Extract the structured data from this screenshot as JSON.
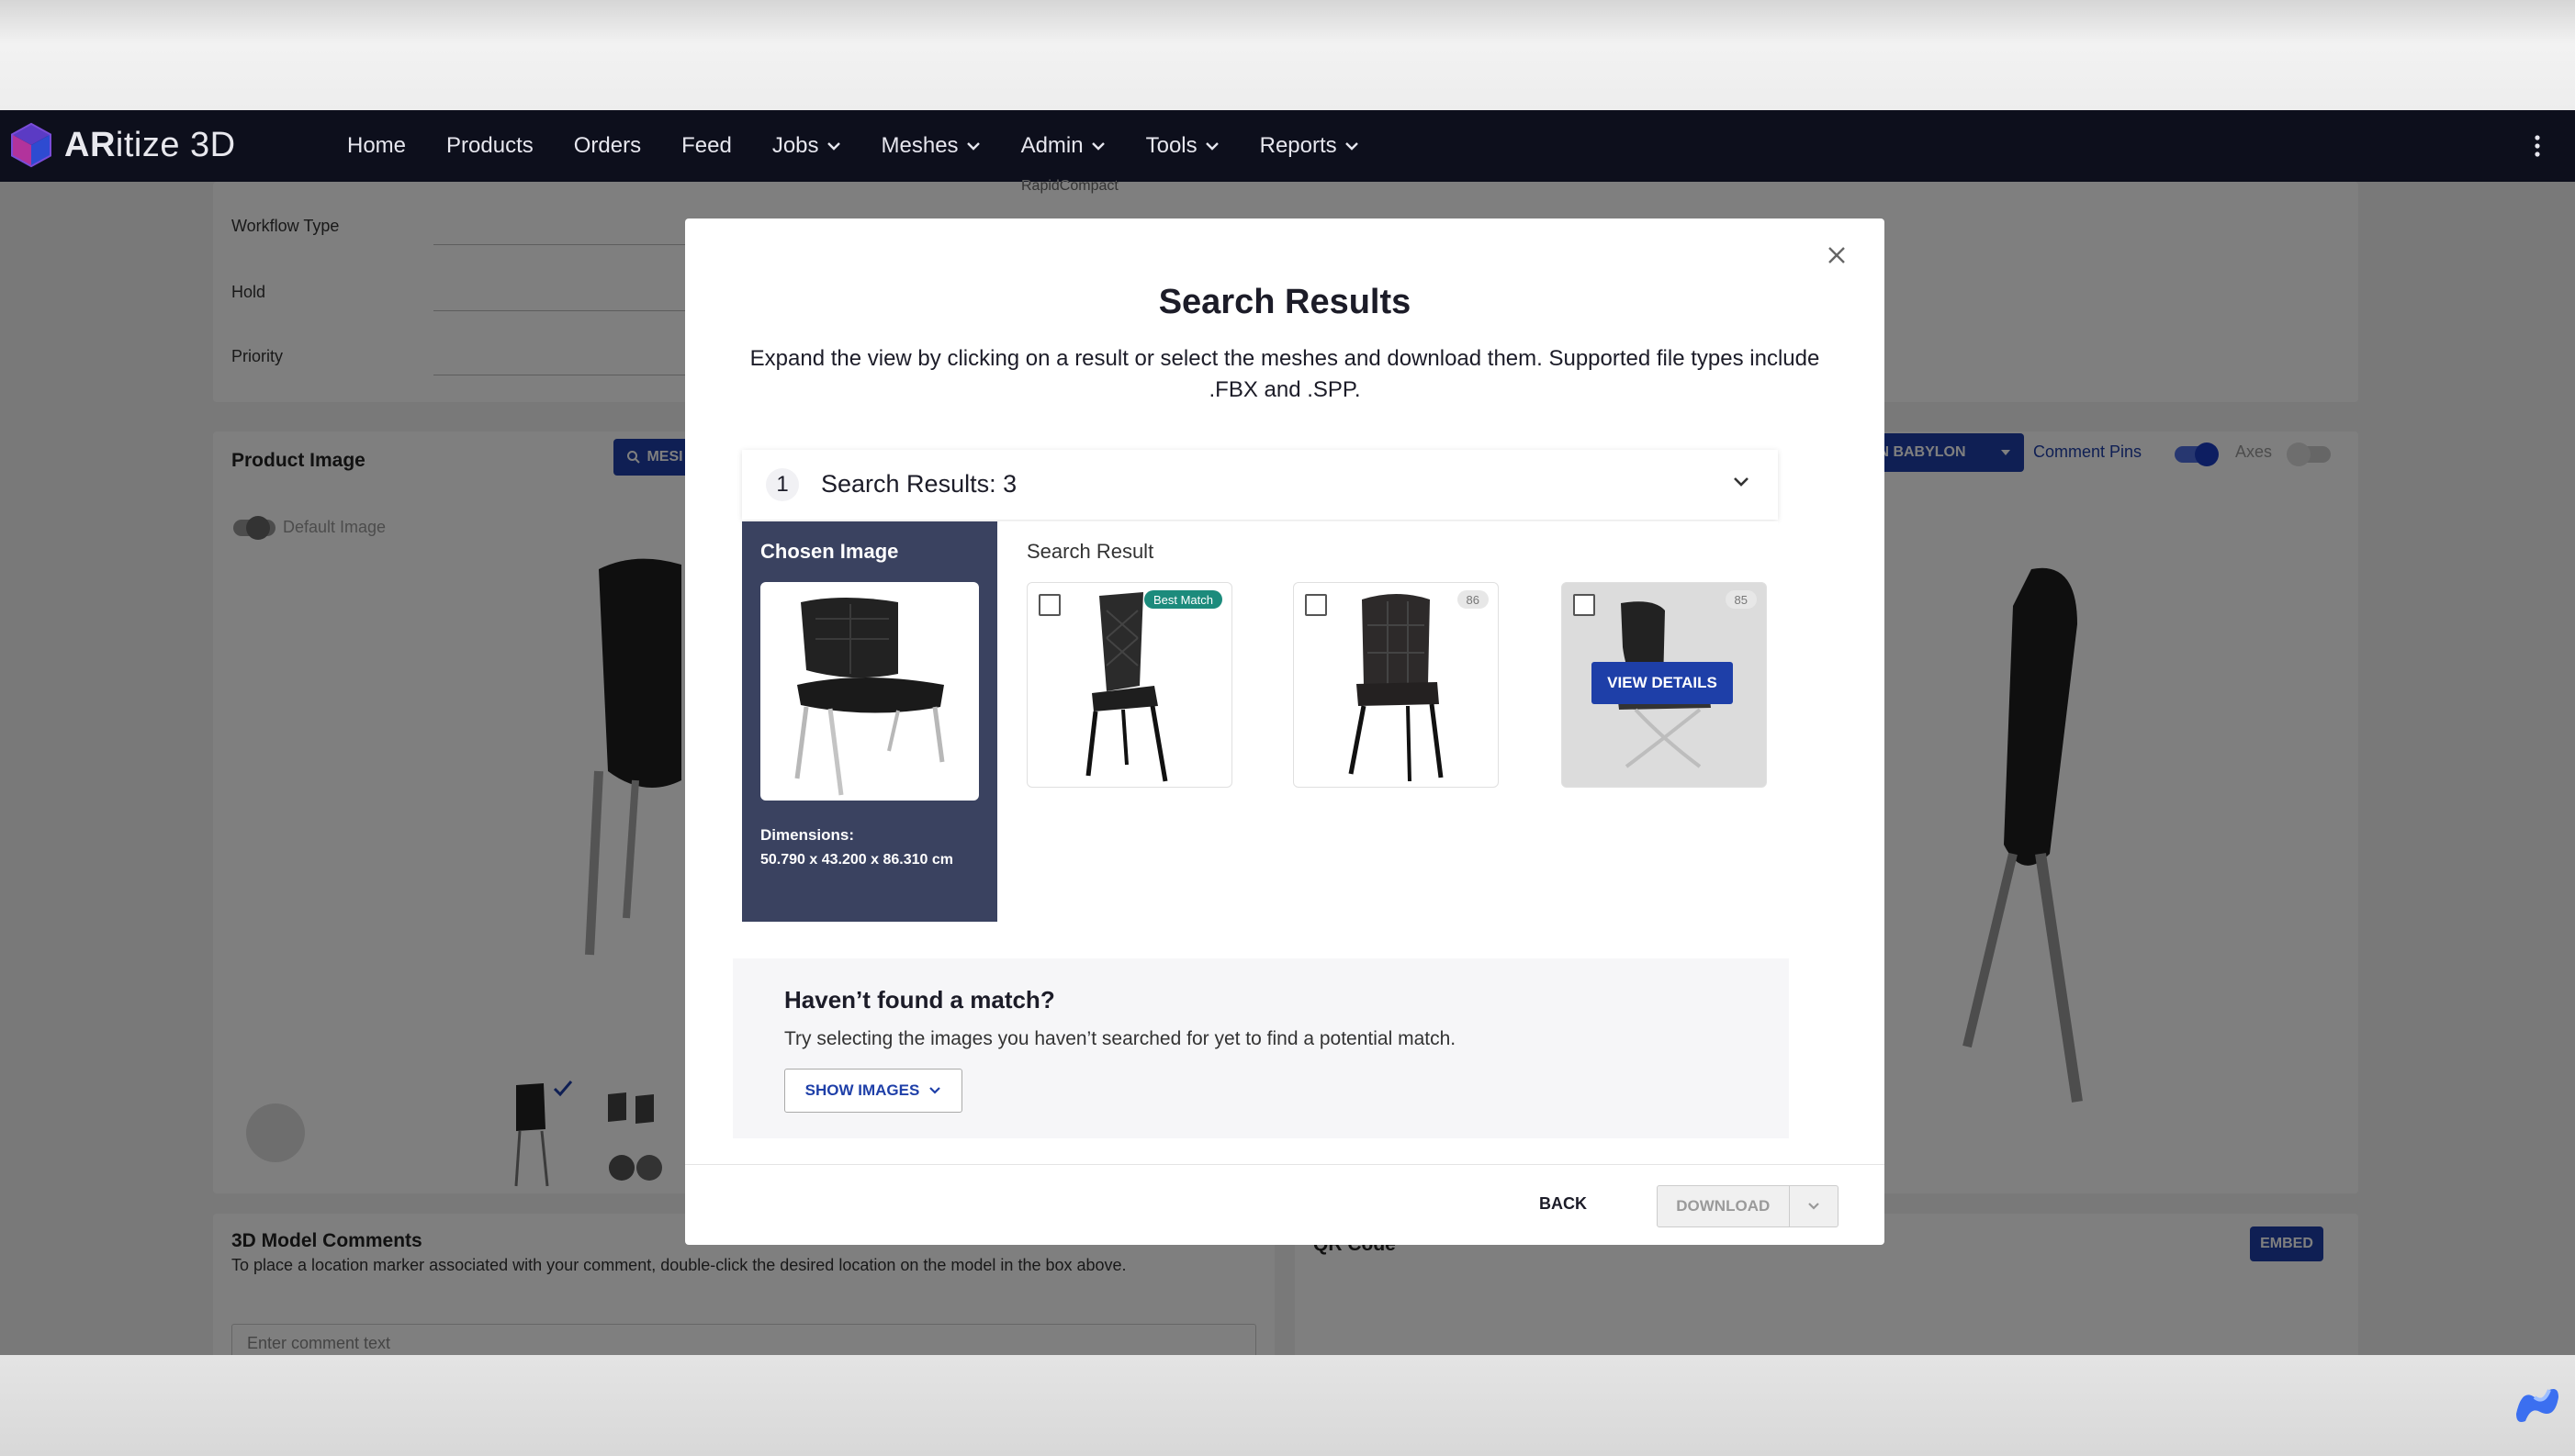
{
  "app": {
    "brand_prefix": "AR",
    "brand_suffix": "itize 3D"
  },
  "nav": {
    "items": [
      {
        "label": "Home",
        "dropdown": false
      },
      {
        "label": "Products",
        "dropdown": false
      },
      {
        "label": "Orders",
        "dropdown": false
      },
      {
        "label": "Feed",
        "dropdown": false
      },
      {
        "label": "Jobs",
        "dropdown": true
      },
      {
        "label": "Meshes",
        "dropdown": true
      },
      {
        "label": "Admin",
        "dropdown": true
      },
      {
        "label": "Tools",
        "dropdown": true
      },
      {
        "label": "Reports",
        "dropdown": true
      }
    ]
  },
  "background": {
    "fields": {
      "workflow_type": "Workflow Type",
      "hold": "Hold",
      "priority": "Priority"
    },
    "partial_value": "RapidCompact",
    "product_image": {
      "title": "Product Image",
      "mesh_button": "MESI",
      "default_image": "Default Image"
    },
    "viewer_controls": {
      "babylon_button": "N BABYLON",
      "comment_pins": "Comment Pins",
      "axes": "Axes"
    },
    "comments": {
      "title": "3D Model Comments",
      "hint": "To place a location marker associated with your comment, double-click the desired location on the model in the box above.",
      "placeholder": "Enter comment text"
    },
    "qr": {
      "title": "QR Code",
      "embed": "EMBED"
    }
  },
  "modal": {
    "title": "Search Results",
    "description": "Expand the view by clicking on a result or select the meshes and download them. Supported file types include .FBX and .SPP.",
    "accordion": {
      "number": "1",
      "title": "Search Results: 3"
    },
    "chosen": {
      "title": "Chosen Image",
      "dimensions_label": "Dimensions:",
      "dimensions_value": "50.790 x 43.200 x 86.310 cm"
    },
    "results": {
      "label": "Search Result",
      "items": [
        {
          "badge": "Best Match",
          "selected": false
        },
        {
          "badge": "86",
          "selected": false
        },
        {
          "badge": "85",
          "selected": false,
          "hover_action": "VIEW DETAILS"
        }
      ]
    },
    "no_match": {
      "title": "Haven’t found a match?",
      "description": "Try selecting the images you haven’t searched for yet to find a potential match.",
      "button": "SHOW IMAGES"
    },
    "footer": {
      "back": "BACK",
      "download": "DOWNLOAD"
    }
  },
  "colors": {
    "primary": "#1e3fa8",
    "header_bg": "#0d0f1c",
    "chosen_panel": "#3a4260",
    "best_match": "#1c8b7c"
  }
}
